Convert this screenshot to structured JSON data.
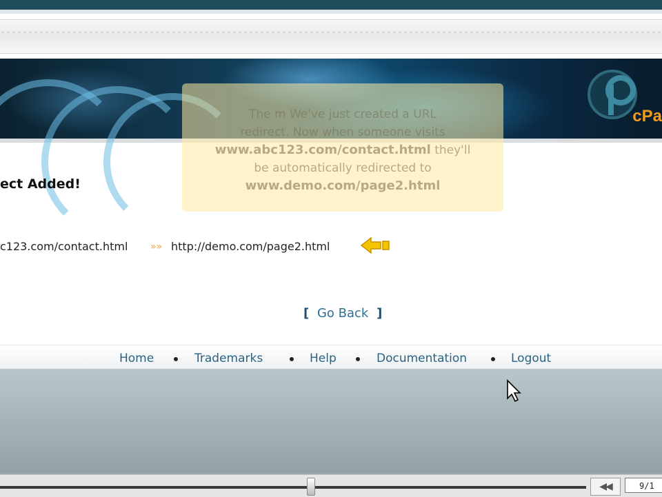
{
  "banner": {
    "logo_text": "cPa"
  },
  "tooltip": {
    "line1": "The m We've just created a URL",
    "line2": "redirect. Now when someone visits",
    "url_from": "www.abc123.com/contact.html",
    "line3_suffix": " they'll",
    "line4": "be automatically redirected to",
    "url_to": "www.demo.com/page2.html"
  },
  "main": {
    "heading": "ect Added!",
    "redirect": {
      "from": "c123.com/contact.html",
      "arrows": "»»",
      "to": "http://demo.com/page2.html"
    },
    "go_back": {
      "open": "[",
      "label": "Go Back",
      "close": "]"
    }
  },
  "footer": {
    "links": [
      "Home",
      "Trademarks",
      "Help",
      "Documentation",
      "Logout"
    ]
  },
  "player": {
    "rewind_label": "◀◀",
    "counter": "9/1",
    "progress_fraction": 0.53
  },
  "colors": {
    "accent": "#f29b1d",
    "link": "#2b6282",
    "banner_dark": "#0b2230"
  }
}
